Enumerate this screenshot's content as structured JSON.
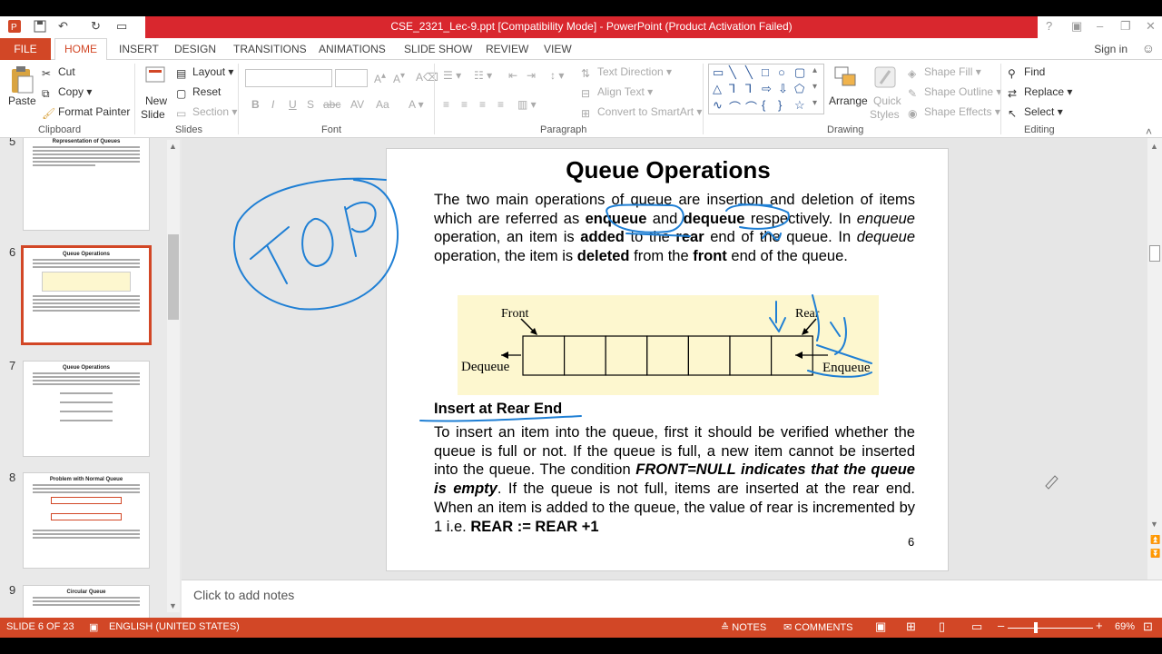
{
  "window": {
    "title": "CSE_2321_Lec-9.ppt [Compatibility Mode] - PowerPoint (Product Activation Failed)"
  },
  "tabs": [
    "FILE",
    "HOME",
    "INSERT",
    "DESIGN",
    "TRANSITIONS",
    "ANIMATIONS",
    "SLIDE SHOW",
    "REVIEW",
    "VIEW"
  ],
  "active_tab": "HOME",
  "signin": "Sign in",
  "ribbon": {
    "clipboard": {
      "paste": "Paste",
      "cut": "Cut",
      "copy": "Copy",
      "format_painter": "Format Painter",
      "label": "Clipboard"
    },
    "slides": {
      "new_slide_1": "New",
      "new_slide_2": "Slide",
      "layout": "Layout",
      "reset": "Reset",
      "section": "Section",
      "label": "Slides"
    },
    "font": {
      "label": "Font"
    },
    "paragraph": {
      "text_direction": "Text Direction",
      "align_text": "Align Text",
      "convert": "Convert to SmartArt",
      "label": "Paragraph"
    },
    "drawing": {
      "arrange": "Arrange",
      "quick_styles_1": "Quick",
      "quick_styles_2": "Styles",
      "shape_fill": "Shape Fill",
      "shape_outline": "Shape Outline",
      "shape_effects": "Shape Effects",
      "label": "Drawing"
    },
    "editing": {
      "find": "Find",
      "replace": "Replace",
      "select": "Select",
      "label": "Editing"
    }
  },
  "thumbnails": [
    {
      "num": "5",
      "title": "Representation of Queues"
    },
    {
      "num": "6",
      "title": "Queue Operations"
    },
    {
      "num": "7",
      "title": "Queue Operations"
    },
    {
      "num": "8",
      "title": "Problem with Normal Queue"
    },
    {
      "num": "9",
      "title": "Circular Queue"
    }
  ],
  "slide": {
    "title": "Queue Operations",
    "p1": {
      "a": "The two main operations of queue are insertion and deletion of items which are referred as ",
      "enqueue": "enqueue",
      "b": " and ",
      "dequeue": "dequeue",
      "c": " respectively. In ",
      "enqueue_i": "enqueue",
      "d": " operation, an item is ",
      "added": "added",
      "e": " to the ",
      "rear": "rear",
      "f": " end of the queue. In ",
      "dequeue_i": "dequeue",
      "g": " operation, the item is ",
      "deleted": "deleted",
      "h": " from the ",
      "front": "front",
      "i": " end of the queue."
    },
    "diagram": {
      "front": "Front",
      "rear": "Rear",
      "dequeue": "Dequeue",
      "enqueue": "Enqueue",
      "cells": 7
    },
    "insert_heading": "Insert at Rear End",
    "p2": {
      "a": "To insert an item into the queue, first it should be verified whether the queue is full or not. If the queue is full, a new item cannot be inserted into the queue. The condition ",
      "cond": "FRONT=NULL indicates that the queue is empty",
      "b": ". If the queue is not full, items are inserted at the rear end. When an item is added to the queue, the value of rear is incremented by 1 i.e. ",
      "code": "REAR := REAR +1"
    },
    "number": "6"
  },
  "annotation": {
    "ink_text": "TOP"
  },
  "notes_placeholder": "Click to add notes",
  "status": {
    "slide": "SLIDE 6 OF 23",
    "language": "ENGLISH (UNITED STATES)",
    "notes": "NOTES",
    "comments": "COMMENTS",
    "zoom": "69%"
  },
  "colors": {
    "accent": "#d24726",
    "title_red": "#d9272e",
    "ink": "#1f7fd4"
  }
}
